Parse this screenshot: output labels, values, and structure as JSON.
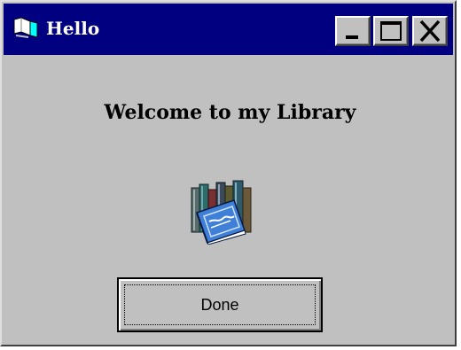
{
  "window": {
    "title": "Hello",
    "app_icon": "window-app-icon",
    "title_bar_color": "#000080",
    "face_color": "#c0c0c0"
  },
  "title_buttons": {
    "minimize_icon": "minimize-icon",
    "maximize_icon": "maximize-icon",
    "close_icon": "close-icon"
  },
  "content": {
    "heading": "Welcome to my Library",
    "image_icon": "library-books-icon",
    "done_label": "Done"
  }
}
